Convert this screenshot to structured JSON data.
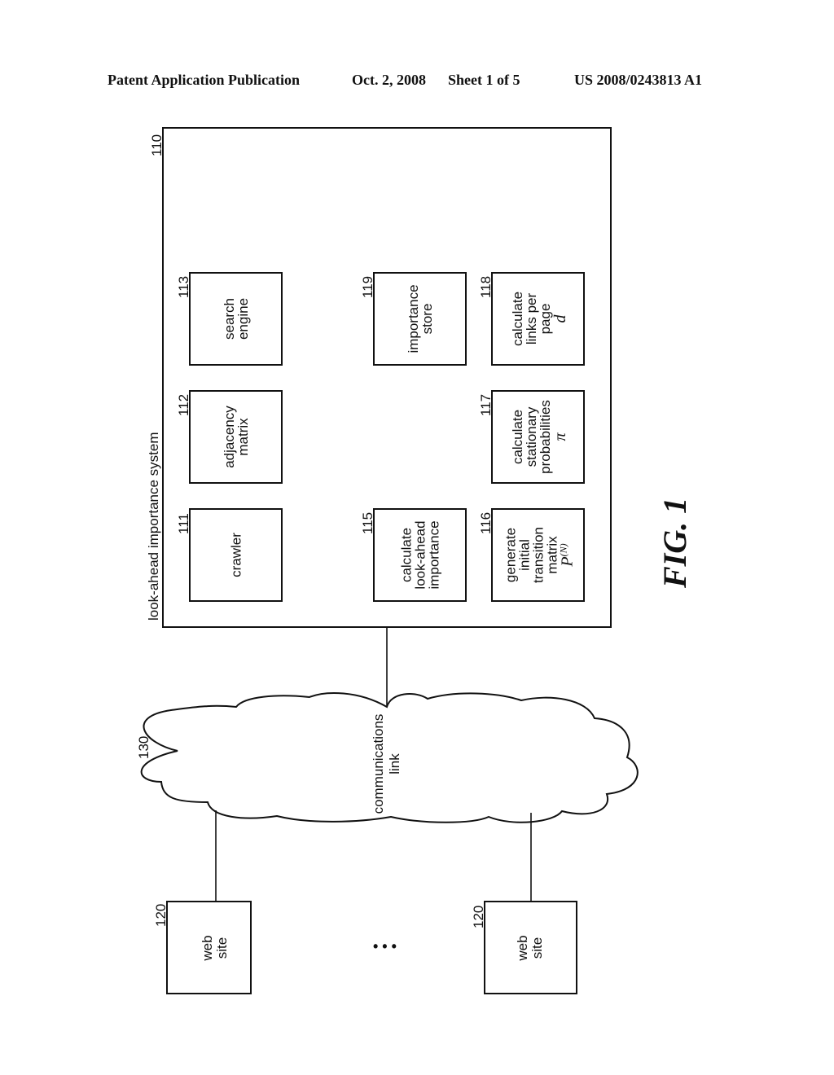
{
  "header": {
    "publication": "Patent Application Publication",
    "date": "Oct. 2, 2008",
    "sheet": "Sheet 1 of 5",
    "number": "US 2008/0243813 A1"
  },
  "system": {
    "ref": "110",
    "title": "look-ahead importance system",
    "components": [
      {
        "ref": "111",
        "lines": [
          "crawler"
        ],
        "symbol": ""
      },
      {
        "ref": "112",
        "lines": [
          "adjacency",
          "matrix"
        ],
        "symbol": ""
      },
      {
        "ref": "113",
        "lines": [
          "search",
          "engine"
        ],
        "symbol": ""
      },
      {
        "ref": "115",
        "lines": [
          "calculate",
          "look-ahead",
          "importance"
        ],
        "symbol": ""
      },
      {
        "ref": "119",
        "lines": [
          "importance",
          "store"
        ],
        "symbol": ""
      },
      {
        "ref": "116",
        "lines": [
          "generate",
          "initial",
          "transition",
          "matrix"
        ],
        "symbol": "P",
        "symbol_sup": "(N)"
      },
      {
        "ref": "117",
        "lines": [
          "calculate",
          "stationary",
          "probabilities"
        ],
        "symbol": "π"
      },
      {
        "ref": "118",
        "lines": [
          "calculate",
          "links per",
          "page"
        ],
        "symbol": "d"
      }
    ]
  },
  "network": {
    "ref": "130",
    "lines": [
      "communications",
      "link"
    ]
  },
  "websites": [
    {
      "ref": "120",
      "lines": [
        "web",
        "site"
      ]
    },
    {
      "ref": "120",
      "lines": [
        "web",
        "site"
      ]
    }
  ],
  "ellipsis": "• • •",
  "figure_label": "FIG. 1"
}
